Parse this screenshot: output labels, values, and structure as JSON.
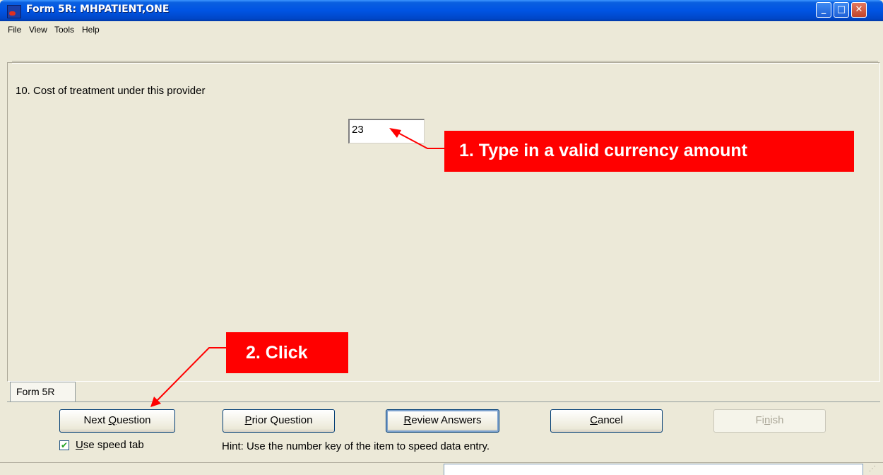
{
  "window": {
    "title": "Form 5R: MHPATIENT,ONE"
  },
  "titlebar_buttons": {
    "minimize": "_",
    "maximize": "□",
    "close": "✕"
  },
  "menu": [
    "File",
    "View",
    "Tools",
    "Help"
  ],
  "question": {
    "text": "10. Cost of treatment under this provider",
    "answer_value": "23"
  },
  "tab": {
    "label": "Form 5R"
  },
  "buttons": {
    "next_pre": "Next ",
    "next_key": "Q",
    "next_post": "uestion",
    "prior_key": "P",
    "prior_post": "rior Question",
    "review_key": "R",
    "review_post": "eview Answers",
    "cancel_key": "C",
    "cancel_post": "ancel",
    "finish_pre": "Fi",
    "finish_key": "n",
    "finish_post": "ish"
  },
  "speed_tab": {
    "checked": true,
    "label_key": "U",
    "label_post": "se speed tab",
    "check_glyph": "✔"
  },
  "hint": "Hint: Use the number key of the item to speed data entry.",
  "callouts": {
    "step1": "1. Type in a valid currency amount",
    "step2": "2. Click"
  },
  "colors": {
    "callout": "#ff0000",
    "titlebar": "#0054e3"
  }
}
